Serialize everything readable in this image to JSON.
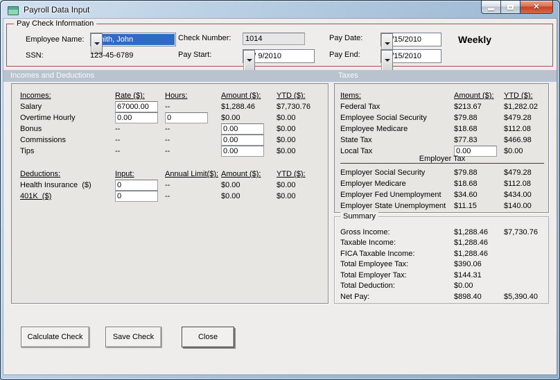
{
  "window": {
    "title": "Payroll Data Input"
  },
  "paycheck": {
    "legend": "Pay Check Information",
    "employee_name": {
      "label": "Employee Name:",
      "value": "Smith, John"
    },
    "ssn": {
      "label": "SSN:",
      "value": "123-45-6789"
    },
    "check_number": {
      "label": "Check Number:",
      "value": "1014"
    },
    "pay_start": {
      "label": "Pay Start:",
      "value": "12/ 9/2010"
    },
    "pay_date": {
      "label": "Pay Date:",
      "value": "12/15/2010"
    },
    "pay_end": {
      "label": "Pay End:",
      "value": "12/15/2010"
    },
    "frequency": "Weekly"
  },
  "sections": {
    "left": "Incomes and Deductions",
    "right": "Taxes"
  },
  "incomes": {
    "headers": {
      "name": "Incomes:",
      "rate": "Rate ($):",
      "hours": "Hours:",
      "amount": "Amount ($):",
      "ytd": "YTD ($):"
    },
    "rows": [
      {
        "label": "Salary",
        "rate": "67000.00",
        "hours": "--",
        "amount": "$1,288.46",
        "ytd": "$7,730.76"
      },
      {
        "label": "Overtime Hourly",
        "rate": "0.00",
        "hours": "0",
        "amount": "$0.00",
        "ytd": "$0.00"
      },
      {
        "label": "Bonus",
        "rate": "--",
        "hours": "--",
        "amount": "0.00",
        "ytd": "$0.00"
      },
      {
        "label": "Commissions",
        "rate": "--",
        "hours": "--",
        "amount": "0.00",
        "ytd": "$0.00"
      },
      {
        "label": "Tips",
        "rate": "--",
        "hours": "--",
        "amount": "0.00",
        "ytd": "$0.00"
      }
    ]
  },
  "deductions": {
    "headers": {
      "name": "Deductions:",
      "input": "Input:",
      "limit": "Annual Limit($):",
      "amount": "Amount ($):",
      "ytd": "YTD ($):"
    },
    "rows": [
      {
        "label": "Health Insurance  ($)",
        "input": "0",
        "limit": "--",
        "amount": "$0.00",
        "ytd": "$0.00"
      },
      {
        "label": "401K  ($)",
        "input": "0",
        "limit": "--",
        "amount": "$0.00",
        "ytd": "$0.00"
      }
    ]
  },
  "taxes": {
    "headers": {
      "items": "Items:",
      "amount": "Amount ($):",
      "ytd": "YTD ($):"
    },
    "employee_rows": [
      {
        "label": "Federal Tax",
        "amount": "$213.67",
        "ytd": "$1,282.02"
      },
      {
        "label": "Employee Social Security",
        "amount": "$79.88",
        "ytd": "$479.28"
      },
      {
        "label": "Employee Medicare",
        "amount": "$18.68",
        "ytd": "$112.08"
      },
      {
        "label": "State Tax",
        "amount": "$77.83",
        "ytd": "$466.98"
      },
      {
        "label": "Local Tax",
        "amount": "0.00",
        "ytd": "$0.00"
      }
    ],
    "employer_header": "Employer Tax",
    "employer_rows": [
      {
        "label": "Employer Social Security",
        "amount": "$79.88",
        "ytd": "$479.28"
      },
      {
        "label": "Employer Medicare",
        "amount": "$18.68",
        "ytd": "$112.08"
      },
      {
        "label": "Employer Fed Unemployment",
        "amount": "$34.60",
        "ytd": "$434.00"
      },
      {
        "label": "Employer State Unemployment",
        "amount": "$11.15",
        "ytd": "$140.00"
      }
    ]
  },
  "summary": {
    "legend": "Summary",
    "rows": [
      {
        "label": "Gross Income:",
        "amount": "$1,288.46",
        "ytd": "$7,730.76"
      },
      {
        "label": "Taxable Income:",
        "amount": "$1,288.46",
        "ytd": ""
      },
      {
        "label": "FICA Taxable Income:",
        "amount": "$1,288.46",
        "ytd": ""
      },
      {
        "label": "Total Employee Tax:",
        "amount": "$390.06",
        "ytd": ""
      },
      {
        "label": "Total Employer Tax:",
        "amount": "$144.31",
        "ytd": ""
      },
      {
        "label": "Total Deduction:",
        "amount": "$0.00",
        "ytd": ""
      },
      {
        "label": "Net Pay:",
        "amount": "$898.40",
        "ytd": "$5,390.40"
      }
    ]
  },
  "buttons": {
    "calculate": "Calculate Check",
    "save": "Save Check",
    "close": "Close"
  }
}
